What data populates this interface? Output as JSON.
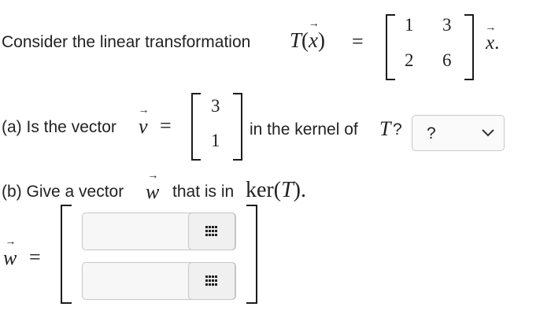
{
  "intro": {
    "text": "Consider the linear transformation",
    "T": "T",
    "x_var": "x",
    "equals": "=",
    "matrix": [
      [
        "1",
        "3"
      ],
      [
        "2",
        "6"
      ]
    ],
    "tail_period": "."
  },
  "part_a": {
    "prefix": "(a) Is the vector",
    "v_var": "v",
    "equals": "=",
    "vector": [
      "3",
      "1"
    ],
    "suffix": "in the kernel of",
    "T": "T",
    "question_mark": "?",
    "select": {
      "value": "?",
      "icon": "chevron-down-icon"
    }
  },
  "part_b": {
    "prefix": "(b) Give a vector",
    "w_var": "w",
    "suffix": "that is in",
    "ker": "ker",
    "T": "T",
    "period": ".",
    "lhs_var": "w",
    "equals": "=",
    "inputs": [
      {
        "value": "",
        "button_icon": "keypad-icon"
      },
      {
        "value": "",
        "button_icon": "keypad-icon"
      }
    ]
  }
}
